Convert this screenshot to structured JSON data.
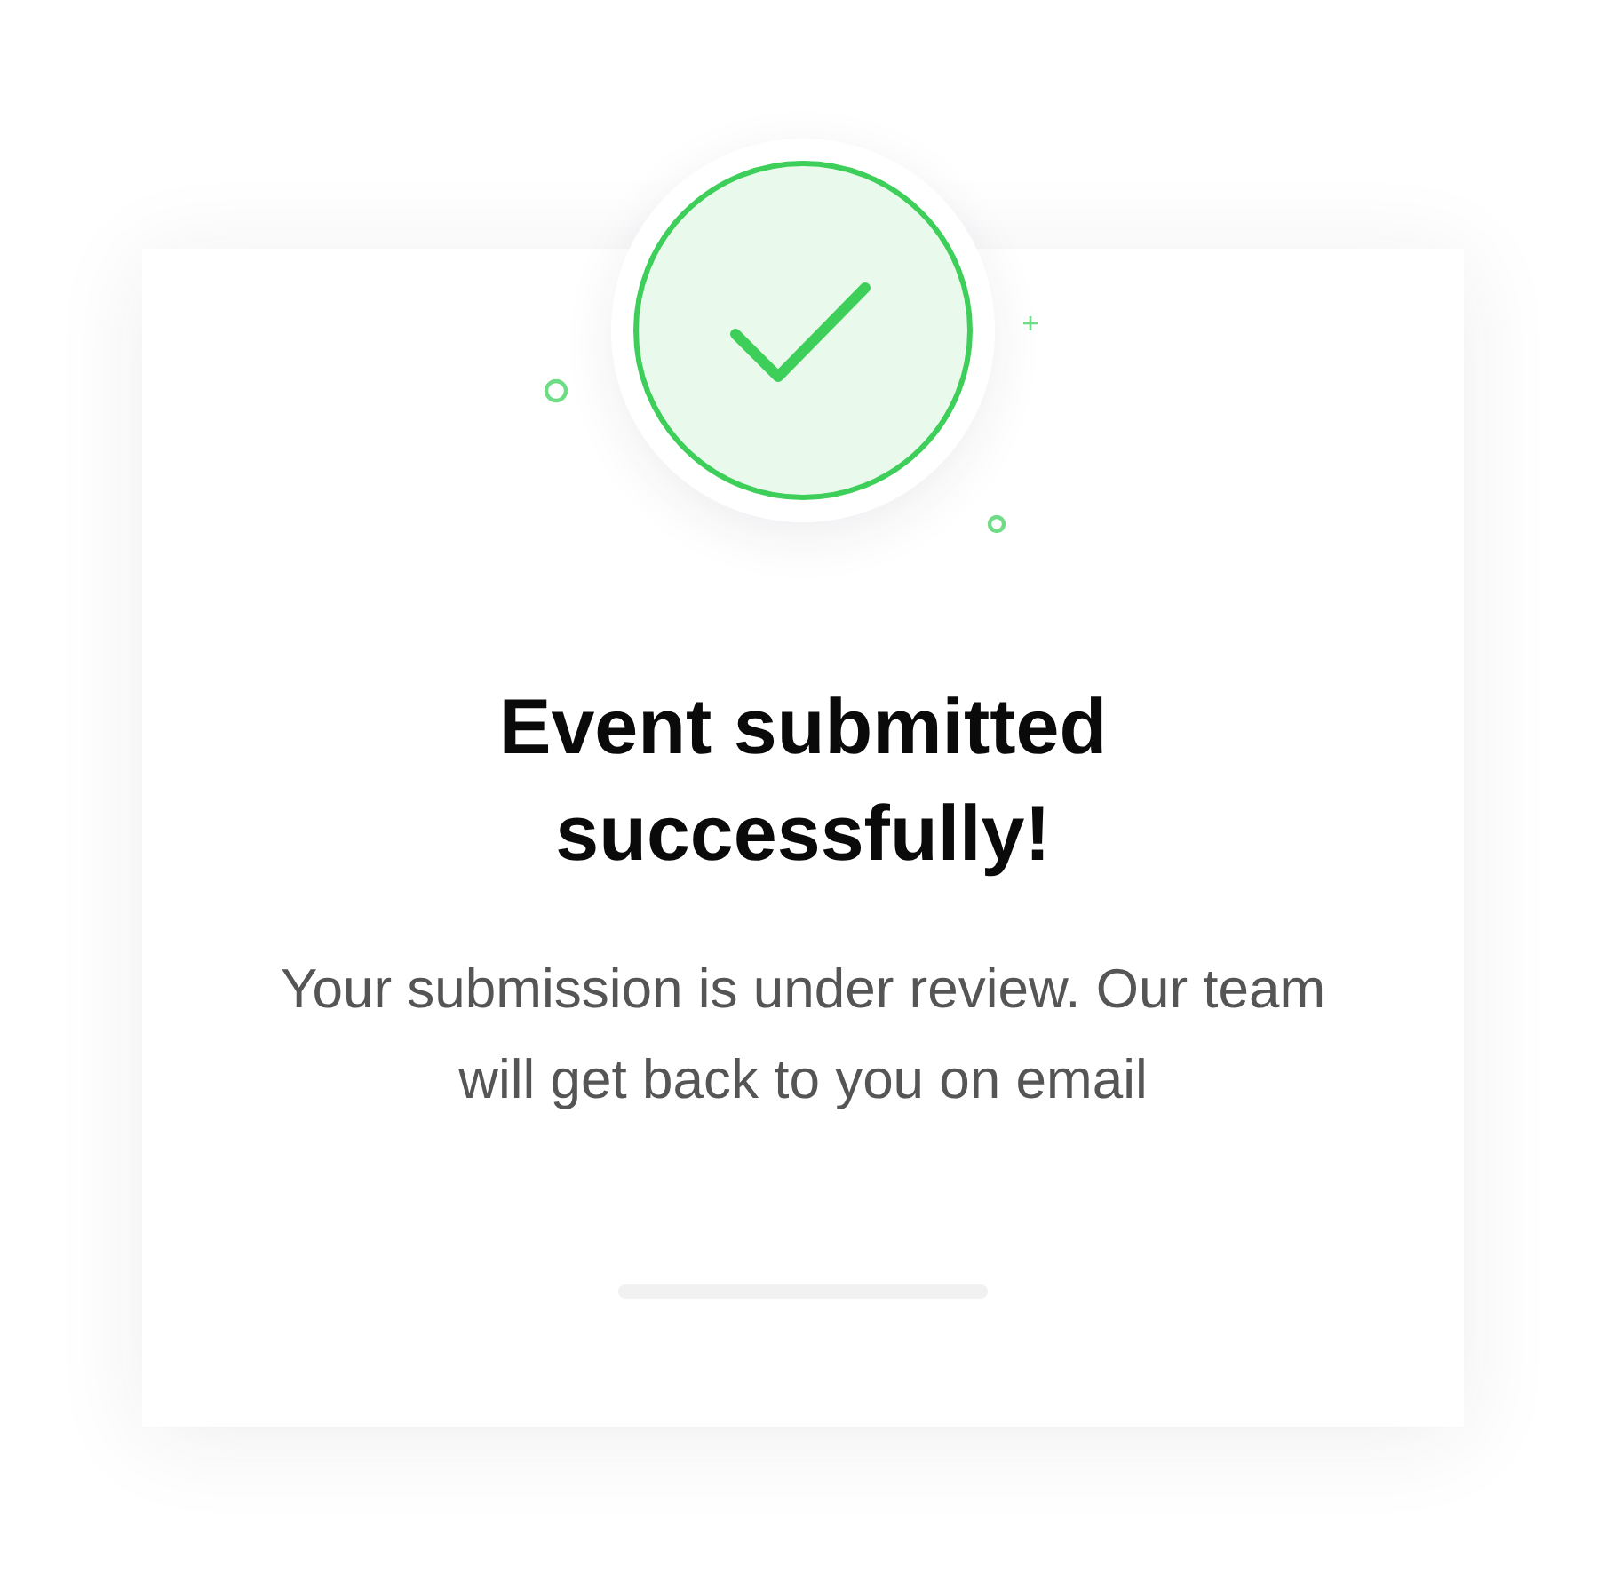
{
  "dialog": {
    "title": "Event submitted successfully!",
    "message": "Your submission is under review. Our team will get back to you on email"
  }
}
